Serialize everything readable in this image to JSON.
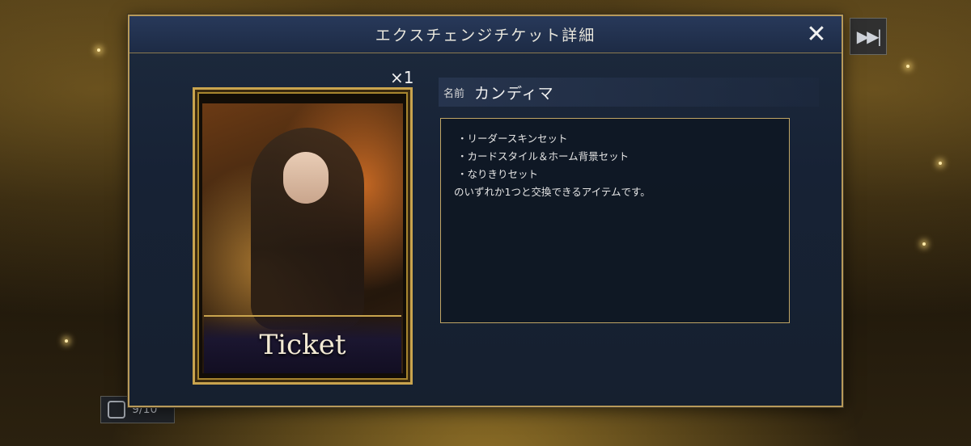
{
  "dialog": {
    "title": "エクスチェンジチケット詳細",
    "close_label": "✕"
  },
  "skip_button": {
    "icon": "fast-forward-icon",
    "label": "▶▶|"
  },
  "counter": {
    "icon": "cards-icon",
    "value": "9/10"
  },
  "ticket": {
    "label": "Ticket",
    "quantity": "×1"
  },
  "item": {
    "name_label": "名前",
    "name": "カンディマ",
    "description_lines": [
      "・リーダースキンセット",
      "・カードスタイル＆ホーム背景セット",
      "・なりきりセット",
      "のいずれか1つと交換できるアイテムです。"
    ]
  },
  "colors": {
    "frame_gold": "#c9a44e",
    "panel_blue": "#172235",
    "text": "#e4e4e4"
  }
}
